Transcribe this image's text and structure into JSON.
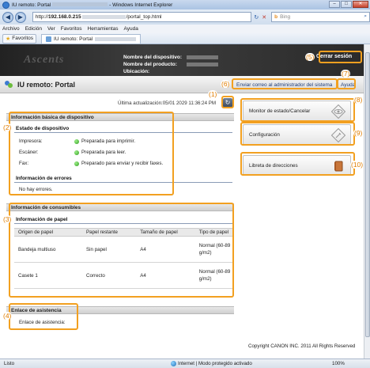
{
  "browser": {
    "title_prefix": "IU remoto: Portal",
    "title_suffix": "- Windows Internet Explorer",
    "url_prefix": "http://",
    "url_host": "192.168.0.215",
    "url_path": "/portal_top.html",
    "search_engine": "Bing",
    "menu": [
      "Archivo",
      "Edición",
      "Ver",
      "Favoritos",
      "Herramientas",
      "Ayuda"
    ],
    "favorites_label": "Favoritos",
    "tab_label": "IU remoto: Portal",
    "status_left": "Listo",
    "status_zone": "Internet | Modo protegido activado",
    "zoom": "100%"
  },
  "header": {
    "device_name_label": "Nombre del dispositivo:",
    "product_name_label": "Nombre del producto:",
    "location_label": "Ubicación:",
    "logout": "Cerrar sesión",
    "portal_title": "IU remoto: Portal",
    "mail_admin": "Enviar correo al administrador del sistema",
    "help": "Ayuda"
  },
  "last_update": "Última actualización:05/01 2029 11:36:24 PM",
  "device_basic": {
    "heading": "Información básica de dispositivo",
    "status_heading": "Estado de dispositivo",
    "rows": [
      {
        "label": "Impresora:",
        "value": "Preparada para imprimir."
      },
      {
        "label": "Escáner:",
        "value": "Preparada para leer."
      },
      {
        "label": "Fax:",
        "value": "Preparado para enviar y recibir faxes."
      }
    ],
    "errors_heading": "Información de errores",
    "errors_value": "No hay errores."
  },
  "consumables": {
    "heading": "Información de consumibles",
    "paper_heading": "Información de papel",
    "columns": [
      "Origen de papel",
      "Papel restante",
      "Tamaño de papel",
      "Tipo de papel"
    ],
    "rows": [
      {
        "source": "Bandeja multiuso",
        "remaining": "Sin papel",
        "size": "A4",
        "type": "Normal (60-89 g/m2)"
      },
      {
        "source": "Casete 1",
        "remaining": "Correcto",
        "size": "A4",
        "type": "Normal (60-89 g/m2)"
      }
    ]
  },
  "support": {
    "heading": "Enlace de asistencia",
    "label": "Enlace de asistencia:"
  },
  "menus": {
    "monitor": "Monitor de estado/Cancelar",
    "settings": "Configuración",
    "address_book": "Libreta de direcciones"
  },
  "copyright": "Copyright CANON INC. 2011 All Rights Reserved",
  "annotations": [
    "(1)",
    "(2)",
    "(3)",
    "(4)",
    "(5)",
    "(6)",
    "(7)",
    "(8)",
    "(9)",
    "(10)"
  ],
  "colors": {
    "annotation": "#f2a020",
    "status_ok": "#2f9b1e"
  }
}
